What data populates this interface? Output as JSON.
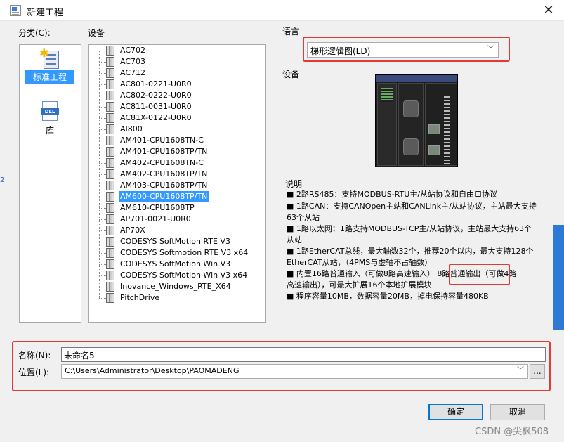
{
  "window": {
    "title": "新建工程",
    "close_glyph": "✕"
  },
  "category": {
    "label": "分类(C):",
    "items": [
      {
        "label": "标准工程",
        "icon": "standard-project-icon",
        "selected": true
      },
      {
        "label": "库",
        "icon": "dll-library-icon",
        "icon_text": "DLL",
        "selected": false
      }
    ]
  },
  "devices": {
    "label": "设备",
    "items": [
      "AC702",
      "AC703",
      "AC712",
      "AC801-0221-U0R0",
      "AC802-0222-U0R0",
      "AC811-0031-U0R0",
      "AC81X-0122-U0R0",
      "AI800",
      "AM401-CPU1608TN-C",
      "AM401-CPU1608TP/TN",
      "AM402-CPU1608TN-C",
      "AM402-CPU1608TP/TN",
      "AM403-CPU1608TP/TN",
      "AM600-CPU1608TP/TN",
      "AM610-CPU1608TP",
      "AP701-0021-U0R0",
      "AP70X",
      "CODESYS SoftMotion RTE V3",
      "CODESYS Softmotion RTE V3 x64",
      "CODESYS SoftMotion Win V3",
      "CODESYS SoftMotion Win V3 x64",
      "Inovance_Windows_RTE_X64",
      "PitchDrive"
    ],
    "selected": "AM600-CPU1608TP/TN"
  },
  "language": {
    "label": "语言",
    "value": "梯形逻辑图(LD)"
  },
  "device_preview": {
    "label": "设备"
  },
  "description": {
    "label": "说明",
    "lines": [
      "■ 2路RS485：支持MODBUS-RTU主/从站协议和自由口协议",
      "■ 1路CAN：支持CANOpen主站和CANLink主/从站协议，主站最大支持",
      "63个从站",
      "■ 1路以太网：1路支持MODBUS-TCP主/从站协议，主站最大支持63个",
      "从站",
      "■ 1路EtherCAT总线，最大轴数32个，推荐20个以内，最大支持128个",
      "EtherCAT从站，（4PMS与虚轴不占轴数）",
      "■ 内置16路普通输入（可做8路高速输入）  8路普通输出（可做4路",
      "高速输出），可最大扩展16个本地扩展模块",
      "■ 程序容量10MB，数据容量20MB，掉电保持容量480KB"
    ]
  },
  "name_field": {
    "label": "名称(N):",
    "value": "未命名5"
  },
  "location_field": {
    "label": "位置(L):",
    "value": "C:\\Users\\Administrator\\Desktop\\PAOMADENG",
    "browse_label": "..."
  },
  "buttons": {
    "ok": "确定",
    "cancel": "取消"
  },
  "watermark": "CSDN @尖枫508",
  "colors": {
    "highlight": "#e53935",
    "selection": "#3399ff",
    "primary_border": "#0078d7"
  }
}
